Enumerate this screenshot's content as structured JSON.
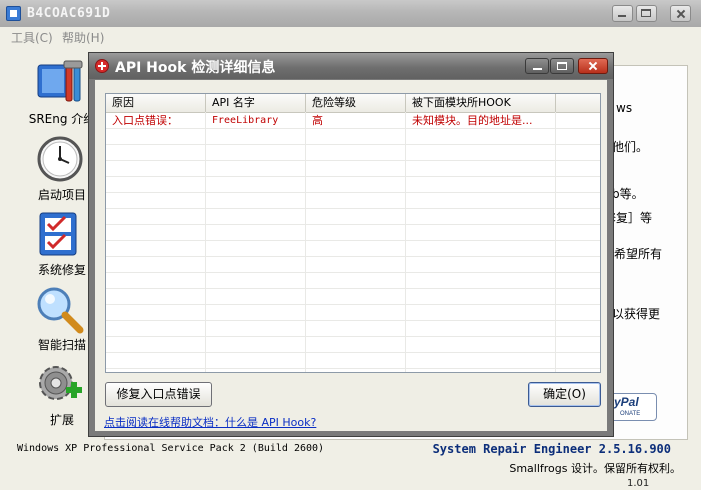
{
  "main_window": {
    "title": "B4COAC691D",
    "menu": [
      "工具(C)",
      "帮助(H)"
    ],
    "sidebar": [
      {
        "label": "SREng 介绍",
        "icon": "tools-icon"
      },
      {
        "label": "启动项目",
        "icon": "clock-icon"
      },
      {
        "label": "系统修复",
        "icon": "checklist-icon"
      },
      {
        "label": "智能扫描",
        "icon": "magnifier-icon"
      },
      {
        "label": "扩展",
        "icon": "gear-plus-icon"
      }
    ],
    "behind_text": [
      "ws",
      "他们。",
      "b等。",
      "修复］等",
      "希望所有",
      "以获得更"
    ],
    "paypal": {
      "label": "yPal",
      "sub": "ONATE"
    },
    "status": {
      "os": "Windows XP Professional Service Pack 2 (Build 2600)",
      "product": "System Repair Engineer 2.5.16.900",
      "copyright": "Smallfrogs 设计。保留所有权利。",
      "fragment": "1.01"
    }
  },
  "dialog": {
    "title": "API Hook 检测详细信息",
    "columns": [
      "原因",
      "API 名字",
      "危险等级",
      "被下面模块所HOOK"
    ],
    "rows": [
      {
        "reason": "入口点错误：",
        "api": "FreeLibrary",
        "level": "高",
        "module": "未知模块。目的地址是..."
      }
    ],
    "repair_button": "修复入口点错误",
    "ok_button": "确定(O)",
    "help_link": "点击阅读在线帮助文档：什么是 API Hook?"
  },
  "colors": {
    "error_text": "#c00000",
    "link": "#0a2ec4",
    "dialog_frame": "#7a7a7a"
  }
}
